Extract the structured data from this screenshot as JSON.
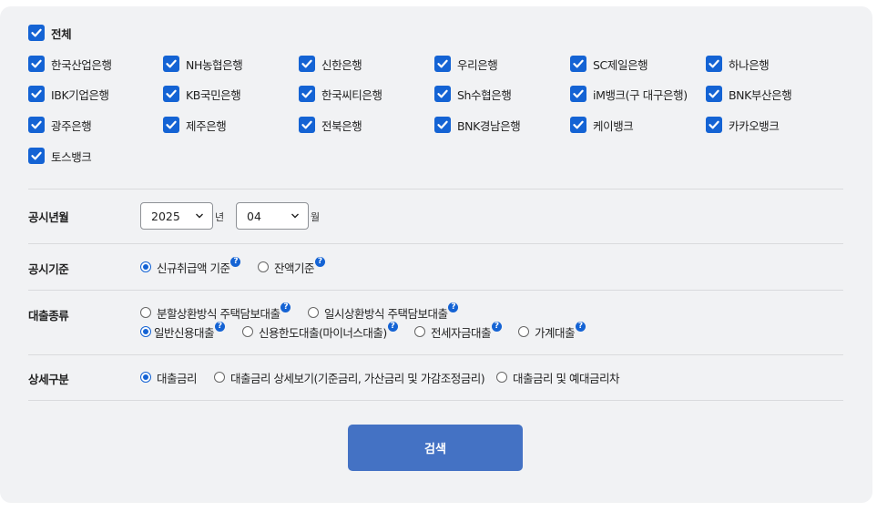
{
  "banks": {
    "all_label": "전체",
    "items": [
      "한국산업은행",
      "NH농협은행",
      "신한은행",
      "우리은행",
      "SC제일은행",
      "하나은행",
      "IBK기업은행",
      "KB국민은행",
      "한국씨티은행",
      "Sh수협은행",
      "iM뱅크(구 대구은행)",
      "BNK부산은행",
      "광주은행",
      "제주은행",
      "전북은행",
      "BNK경남은행",
      "케이뱅크",
      "카카오뱅크",
      "토스뱅크"
    ]
  },
  "period": {
    "label": "공시년월",
    "year_value": "2025",
    "year_unit": "년",
    "month_value": "04",
    "month_unit": "월"
  },
  "basis": {
    "label": "공시기준",
    "options": [
      "신규취급액 기준",
      "잔액기준"
    ],
    "selected": "신규취급액 기준"
  },
  "loan_type": {
    "label": "대출종류",
    "options": [
      "분할상환방식 주택담보대출",
      "일시상환방식 주택담보대출",
      "일반신용대출",
      "신용한도대출(마이너스대출)",
      "전세자금대출",
      "가계대출"
    ],
    "selected": "일반신용대출"
  },
  "detail": {
    "label": "상세구분",
    "options": [
      "대출금리",
      "대출금리 상세보기(기준금리, 가산금리 및 가감조정금리)",
      "대출금리 및 예대금리차"
    ],
    "selected": "대출금리"
  },
  "help_glyph": "?",
  "search_button": "검색",
  "colors": {
    "accent": "#1463d4",
    "button": "#4472c4",
    "panel": "#f1f2f4"
  }
}
